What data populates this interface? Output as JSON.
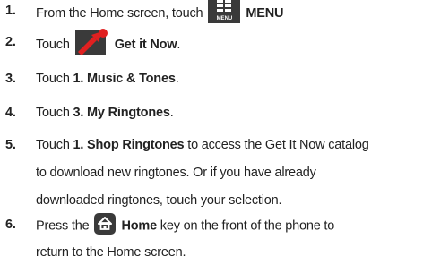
{
  "steps": [
    {
      "num": "1.",
      "pre": "From the Home screen, touch",
      "bold": "MENU",
      "post": "",
      "icon": "menu-icon",
      "icon_label": "MENU"
    },
    {
      "num": "2.",
      "pre": "Touch",
      "bold": "Get it Now",
      "post": ".",
      "icon": "get-it-now-icon"
    },
    {
      "num": "3.",
      "pre": "Touch ",
      "bold": "1. Music & Tones",
      "post": "."
    },
    {
      "num": "4.",
      "pre": "Touch ",
      "bold": "3. My Ringtones",
      "post": "."
    },
    {
      "num": "5.",
      "pre": "Touch ",
      "bold": "1. Shop Ringtones",
      "post": " to access the Get It Now catalog",
      "line2": "to download new ringtones. Or if you have already",
      "line3": "downloaded ringtones, touch your selection."
    },
    {
      "num": "6.",
      "pre": "Press the",
      "bold": "Home",
      "post": " key on the front of the phone to",
      "line2": "return to the Home screen.",
      "icon": "home-icon"
    }
  ],
  "colors": {
    "text": "#222222",
    "icon_dark": "#3a3a3a",
    "icon_red": "#e02020"
  }
}
